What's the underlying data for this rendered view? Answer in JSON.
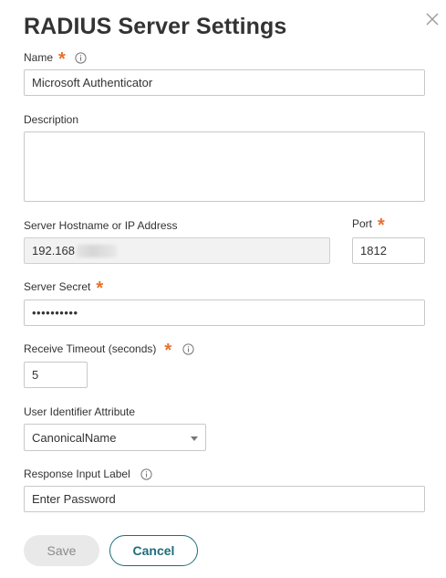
{
  "dialog": {
    "title": "RADIUS Server Settings",
    "close_icon": "close-icon"
  },
  "fields": {
    "name": {
      "label": "Name",
      "required": "*",
      "info_icon": "info-icon",
      "value": "Microsoft Authenticator"
    },
    "description": {
      "label": "Description",
      "value": ""
    },
    "server_hostname": {
      "label": "Server Hostname or IP Address",
      "value_visible": "192.168",
      "obscured": true
    },
    "port": {
      "label": "Port",
      "required": "*",
      "value": "1812"
    },
    "server_secret": {
      "label": "Server Secret",
      "required": "*",
      "value": "••••••••••"
    },
    "receive_timeout": {
      "label": "Receive Timeout (seconds)",
      "required": "*",
      "info_icon": "info-icon",
      "value": "5"
    },
    "user_identifier": {
      "label": "User Identifier Attribute",
      "selected": "CanonicalName",
      "caret_icon": "caret-down-icon"
    },
    "response_input_label": {
      "label": "Response Input Label",
      "info_icon": "info-icon",
      "value": "Enter Password"
    }
  },
  "buttons": {
    "save": "Save",
    "cancel": "Cancel"
  },
  "colors": {
    "required": "#e8702a",
    "primary": "#1e6d7a",
    "text": "#333333",
    "border": "#c8c8c8",
    "disabled_bg": "#e9e9e9",
    "readonly_bg": "#f2f2f2"
  }
}
